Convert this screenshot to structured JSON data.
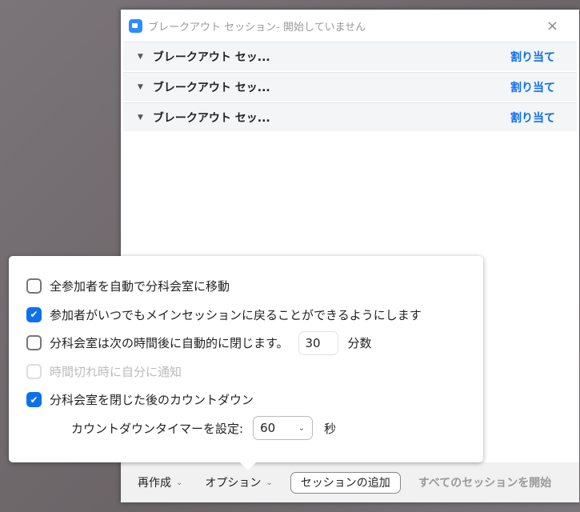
{
  "window": {
    "title": "ブレークアウト セッション- 開始していません",
    "close": "×"
  },
  "rooms": [
    {
      "name": "ブレークアウト セッ...",
      "action": "割り当て"
    },
    {
      "name": "ブレークアウト セッ...",
      "action": "割り当て"
    },
    {
      "name": "ブレークアウト セッ...",
      "action": "割り当て"
    }
  ],
  "footer": {
    "recreate": "再作成",
    "options": "オプション",
    "add_session": "セッションの追加",
    "start_all": "すべてのセッションを開始"
  },
  "options": [
    {
      "label": "全参加者を自動で分科会室に移動",
      "checked": false
    },
    {
      "label": "参加者がいつでもメインセッションに戻ることができるようにします",
      "checked": true
    },
    {
      "label": "分科会室は次の時間後に自動的に閉じます。",
      "checked": false,
      "value": "30",
      "unit": "分数"
    },
    {
      "label": "時間切れ時に自分に通知",
      "checked": false,
      "disabled": true
    },
    {
      "label": "分科会室を閉じた後のカウントダウン",
      "checked": true
    }
  ],
  "countdown": {
    "label": "カウントダウンタイマーを設定:",
    "value": "60",
    "unit": "秒"
  },
  "colors": {
    "accent": "#0e71eb"
  }
}
